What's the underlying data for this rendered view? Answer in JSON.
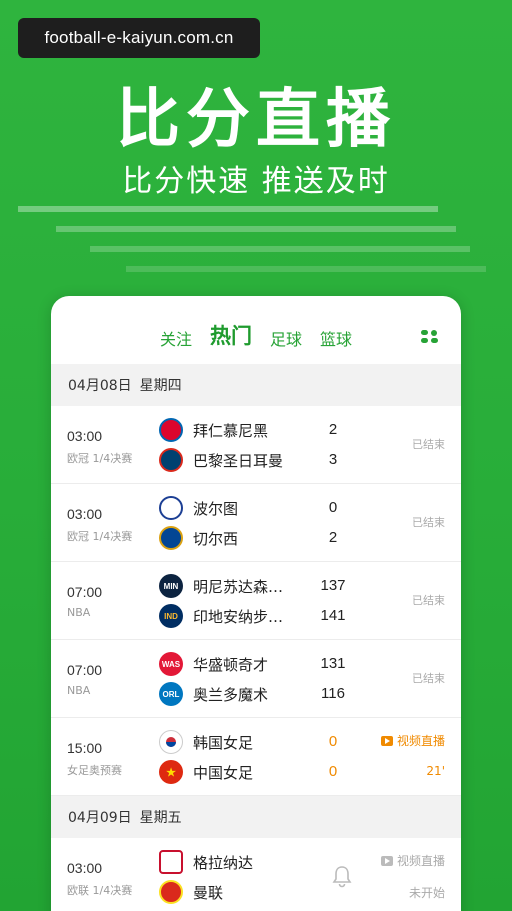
{
  "watermark": "football-e-kaiyun.com.cn",
  "hero": {
    "title": "比分直播",
    "subtitle": "比分快速 推送及时"
  },
  "tabs": {
    "follow": "关注",
    "hot": "热门",
    "football": "足球",
    "basketball": "篮球"
  },
  "days": [
    {
      "date": "04月08日",
      "weekday": "星期四",
      "matches": [
        {
          "time": "03:00",
          "league": "欧冠 1/4决赛",
          "home": "拜仁慕尼黑",
          "away": "巴黎圣日耳曼",
          "home_score": "2",
          "away_score": "3",
          "status": "已结束"
        },
        {
          "time": "03:00",
          "league": "欧冠 1/4决赛",
          "home": "波尔图",
          "away": "切尔西",
          "home_score": "0",
          "away_score": "2",
          "status": "已结束"
        },
        {
          "time": "07:00",
          "league": "NBA",
          "home": "明尼苏达森…",
          "away": "印地安纳步…",
          "home_score": "137",
          "away_score": "141",
          "status": "已结束",
          "home_badge": "MIN",
          "away_badge": "IND"
        },
        {
          "time": "07:00",
          "league": "NBA",
          "home": "华盛顿奇才",
          "away": "奥兰多魔术",
          "home_score": "131",
          "away_score": "116",
          "status": "已结束",
          "home_badge": "WAS",
          "away_badge": "ORL"
        },
        {
          "time": "15:00",
          "league": "女足奥预赛",
          "home": "韩国女足",
          "away": "中国女足",
          "home_score": "0",
          "away_score": "0",
          "live_label": "视频直播",
          "minute": "21'"
        }
      ]
    },
    {
      "date": "04月09日",
      "weekday": "星期五",
      "matches": [
        {
          "time": "03:00",
          "league": "欧联 1/4决赛",
          "home": "格拉纳达",
          "away": "曼联",
          "live_label": "视频直播",
          "status": "未开始"
        }
      ]
    }
  ],
  "colors": {
    "brand_green": "#28ad39",
    "live_orange": "#f08a00"
  }
}
